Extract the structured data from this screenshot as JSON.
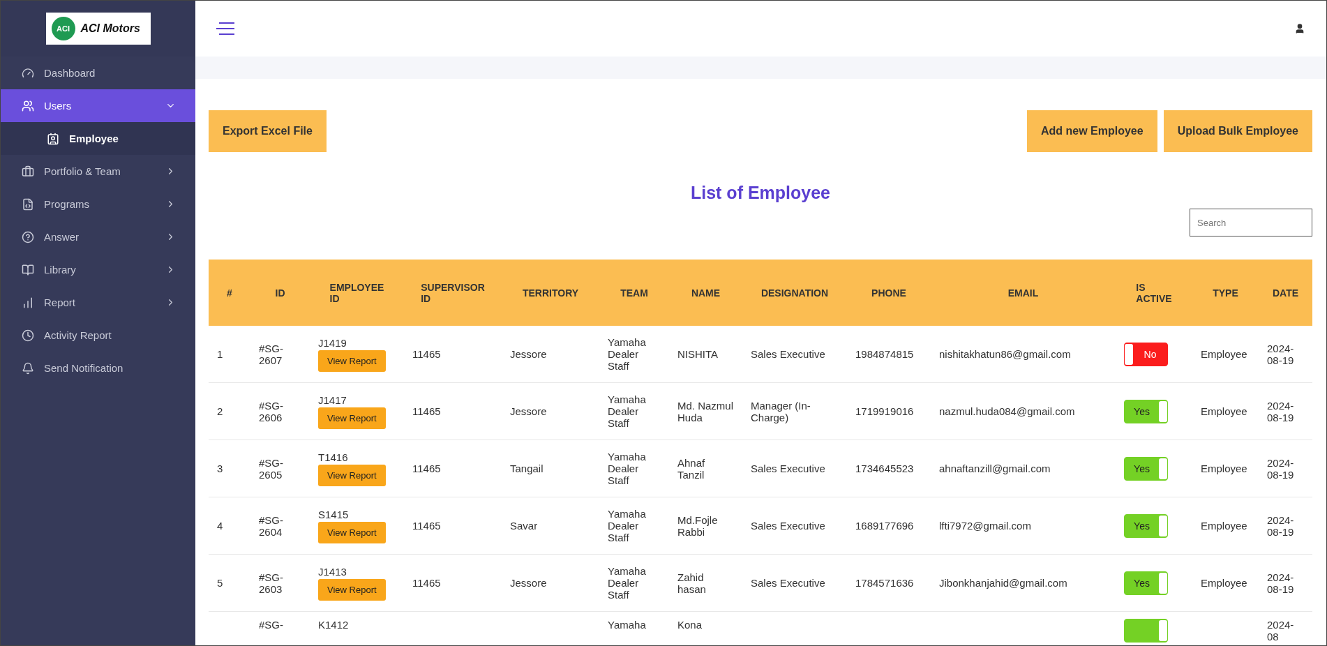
{
  "logo": {
    "badge": "ACI",
    "name": "ACI Motors"
  },
  "sidebar": {
    "items": [
      {
        "label": "Dashboard",
        "kind": "link",
        "selected": false
      },
      {
        "label": "Users",
        "kind": "group",
        "selected": true,
        "expanded": true,
        "children": [
          {
            "label": "Employee",
            "selected": true
          }
        ]
      },
      {
        "label": "Portfolio & Team",
        "kind": "group",
        "selected": false,
        "expanded": false
      },
      {
        "label": "Programs",
        "kind": "group",
        "selected": false,
        "expanded": false
      },
      {
        "label": "Answer",
        "kind": "group",
        "selected": false,
        "expanded": false
      },
      {
        "label": "Library",
        "kind": "group",
        "selected": false,
        "expanded": false
      },
      {
        "label": "Report",
        "kind": "group",
        "selected": false,
        "expanded": false
      },
      {
        "label": "Activity Report",
        "kind": "link",
        "selected": false
      },
      {
        "label": "Send Notification",
        "kind": "link",
        "selected": false
      }
    ]
  },
  "toolbar": {
    "left_buttons": [
      "Export Excel File"
    ],
    "right_buttons": [
      "Add new Employee",
      "Upload Bulk Employee"
    ]
  },
  "title": "List of Employee",
  "search": {
    "placeholder": "Search"
  },
  "table": {
    "columns": [
      "#",
      "ID",
      "EMPLOYEE ID",
      "SUPERVISOR ID",
      "TERRITORY",
      "TEAM",
      "NAME",
      "DESIGNATION",
      "PHONE",
      "EMAIL",
      "IS ACTIVE",
      "TYPE",
      "DATE"
    ],
    "rows": [
      {
        "num": "1",
        "id": "#SG-2607",
        "employee_id": "J1419",
        "report_button": "View Report",
        "supervisor_id": "11465",
        "territory": "Jessore",
        "team": "Yamaha Dealer Staff",
        "name": "NISHITA",
        "designation": "Sales Executive",
        "phone": "1984874815",
        "email": "nishitakhatun86@gmail.com",
        "active": false,
        "active_label": "No",
        "type": "Employee",
        "date": "2024-08-19"
      },
      {
        "num": "2",
        "id": "#SG-2606",
        "employee_id": "J1417",
        "report_button": "View Report",
        "supervisor_id": "11465",
        "territory": "Jessore",
        "team": "Yamaha Dealer Staff",
        "name": "Md. Nazmul Huda",
        "designation": "Manager (In-Charge)",
        "phone": "1719919016",
        "email": "nazmul.huda084@gmail.com",
        "active": true,
        "active_label": "Yes",
        "type": "Employee",
        "date": "2024-08-19"
      },
      {
        "num": "3",
        "id": "#SG-2605",
        "employee_id": "T1416",
        "report_button": "View Report",
        "supervisor_id": "11465",
        "territory": "Tangail",
        "team": "Yamaha Dealer Staff",
        "name": "Ahnaf Tanzil",
        "designation": "Sales Executive",
        "phone": "1734645523",
        "email": "ahnaftanzill@gmail.com",
        "active": true,
        "active_label": "Yes",
        "type": "Employee",
        "date": "2024-08-19"
      },
      {
        "num": "4",
        "id": "#SG-2604",
        "employee_id": "S1415",
        "report_button": "View Report",
        "supervisor_id": "11465",
        "territory": "Savar",
        "team": "Yamaha Dealer Staff",
        "name": "Md.Fojle Rabbi",
        "designation": "Sales Executive",
        "phone": "1689177696",
        "email": "lfti7972@gmail.com",
        "active": true,
        "active_label": "Yes",
        "type": "Employee",
        "date": "2024-08-19"
      },
      {
        "num": "5",
        "id": "#SG-2603",
        "employee_id": "J1413",
        "report_button": "View Report",
        "supervisor_id": "11465",
        "territory": "Jessore",
        "team": "Yamaha Dealer Staff",
        "name": "Zahid hasan",
        "designation": "Sales Executive",
        "phone": "1784571636",
        "email": "Jibonkhanjahid@gmail.com",
        "active": true,
        "active_label": "Yes",
        "type": "Employee",
        "date": "2024-08-19"
      },
      {
        "id": "#SG-",
        "employee_id": "K1412",
        "team": "Yamaha",
        "name": "Kona",
        "active": true,
        "date": "2024-08"
      }
    ]
  }
}
